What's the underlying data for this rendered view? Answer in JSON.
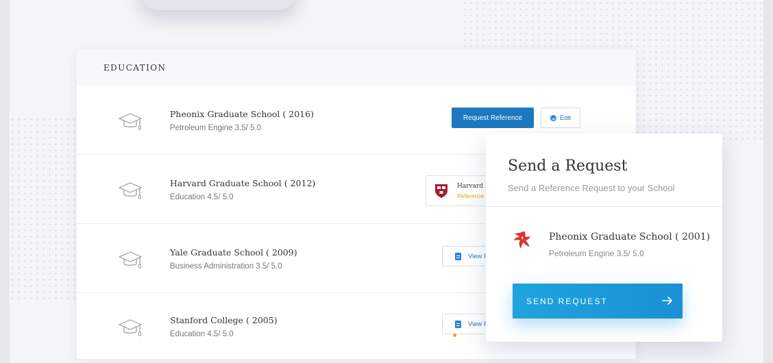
{
  "education": {
    "title": "EDUCATION",
    "entries": [
      {
        "school": "Pheonix Graduate School ( 2016)",
        "detail": "Petroleum Engine 3.5/ 5.0",
        "action_primary": "Request Reference",
        "action_edit": "Edit"
      },
      {
        "school": "Harvard Graduate School  ( 2012)",
        "detail": "Education 4.5/ 5.0",
        "reference_name": "Harvard Esu",
        "reference_status": "Reference Rec"
      },
      {
        "school": "Yale Graduate School ( 2009)",
        "detail": "Business Administration 3.5/ 5.0",
        "action_view": "View Ref"
      },
      {
        "school": "Stanford College  ( 2005)",
        "detail": "Education 4.5/ 5.0",
        "action_view": "View Ref"
      }
    ]
  },
  "send_request": {
    "title": "Send a Request",
    "subtitle": "Send a Reference Request to  your School",
    "school": "Pheonix Graduate School ( 2001)",
    "detail": "Petroleum Engine 3.5/ 5.0",
    "button": "SEND REQUEST"
  },
  "icons": {
    "education": "graduation-cap-icon",
    "edit": "check-circle-icon",
    "view": "document-icon",
    "crest": "harvard-crest-icon",
    "school_logo": "phoenix-bird-icon",
    "send": "arrow-right-icon"
  },
  "colors": {
    "primary": "#1d78bf",
    "send_button": "#1fa3df",
    "pending": "#f5a300",
    "logo_red": "#d9352b",
    "crest_red": "#a51c30"
  }
}
